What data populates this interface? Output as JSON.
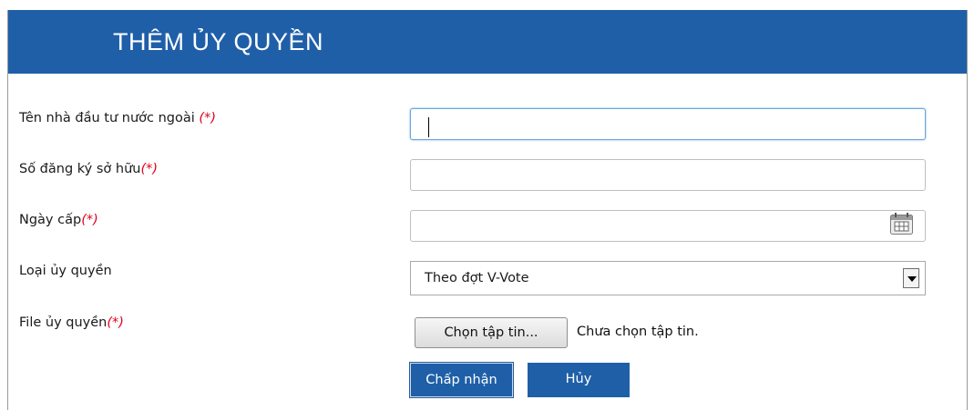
{
  "header": {
    "title": "THÊM ỦY QUYỀN"
  },
  "form": {
    "investor_name": {
      "label": "Tên nhà đầu tư nước ngoài ",
      "required": "(*)",
      "value": ""
    },
    "ownership_no": {
      "label": "Số đăng ký sở hữu",
      "required": "(*)",
      "value": ""
    },
    "issue_date": {
      "label": "Ngày cấp",
      "required": "(*)",
      "value": "",
      "icon": "calendar-icon"
    },
    "auth_type": {
      "label": "Loại ủy quyền",
      "selected": "Theo đợt V-Vote",
      "icon": "chevron-down-icon"
    },
    "auth_file": {
      "label": "File ủy quyền",
      "required": "(*)",
      "button": "Chọn tập tin...",
      "status": "Chưa chọn tập tin."
    }
  },
  "actions": {
    "accept": "Chấp nhận",
    "cancel": "Hủy"
  },
  "colors": {
    "header_bg": "#1f5fa8",
    "required": "#e0001a",
    "button_bg": "#1f5fa8"
  }
}
